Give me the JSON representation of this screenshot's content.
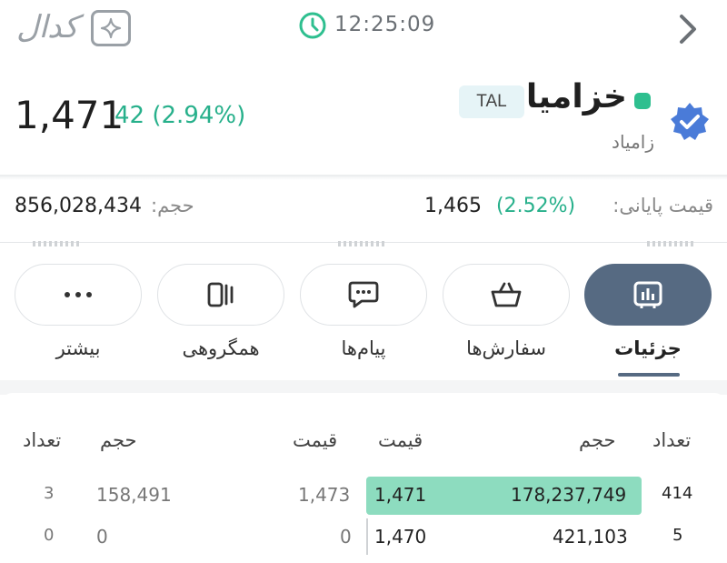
{
  "topbar": {
    "logo": "کدال",
    "time": "12:25:09",
    "icons": [
      "sparkle-icon",
      "clock-icon",
      "chevron-right-icon"
    ]
  },
  "header": {
    "price": "1,471",
    "change": "42 (2.94%)",
    "symbol": "خزامیا",
    "tag": "TAL",
    "company": "زامیاد",
    "status_color": "#2ebf8f",
    "change_color": "#27b08b"
  },
  "stats": {
    "volume_label": "حجم:",
    "volume_value": "856,028,434",
    "close_label": "قیمت پایانی:",
    "close_pct": "(2.52%)",
    "close_value": "1,465"
  },
  "actions": [
    {
      "label": "جزئیات",
      "icon": "chart-icon",
      "active": true
    },
    {
      "label": "سفارش‌ها",
      "icon": "basket-icon",
      "active": false
    },
    {
      "label": "پیام‌ها",
      "icon": "chat-icon",
      "active": false
    },
    {
      "label": "همگروهی",
      "icon": "group-icon",
      "active": false
    },
    {
      "label": "بیشتر",
      "icon": "more-icon",
      "active": false
    }
  ],
  "orderbook": {
    "buy_headers": {
      "count": "تعداد",
      "volume": "حجم",
      "price": "قیمت"
    },
    "sell_headers": {
      "price": "قیمت",
      "volume": "حجم",
      "count": "تعداد"
    },
    "rows": [
      {
        "buy_count": "414",
        "buy_volume": "178,237,749",
        "buy_price": "1,471",
        "sell_price": "1,473",
        "sell_volume": "158,491",
        "sell_count": "3"
      },
      {
        "buy_count": "5",
        "buy_volume": "421,103",
        "buy_price": "1,470",
        "sell_price": "0",
        "sell_volume": "0",
        "sell_count": "0"
      }
    ],
    "bid_color": "#8ddcbf"
  }
}
